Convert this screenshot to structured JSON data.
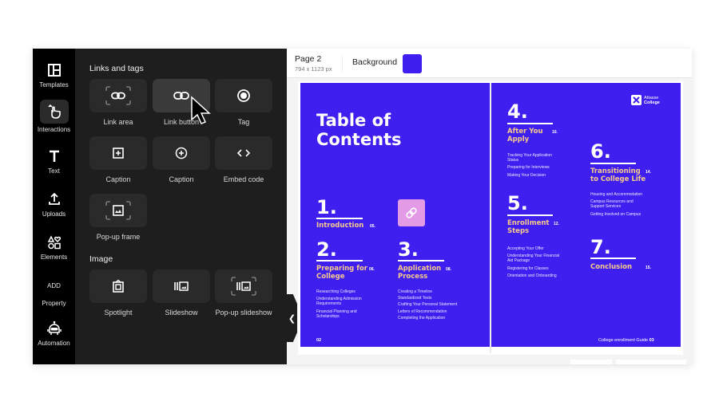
{
  "rail": {
    "items": [
      {
        "label": "Templates",
        "icon": "layout-icon"
      },
      {
        "label": "Interactions",
        "icon": "pointer-hand-icon",
        "active": true
      },
      {
        "label": "Text",
        "icon": "text-icon"
      },
      {
        "label": "Uploads",
        "icon": "upload-icon"
      },
      {
        "label": "Elements",
        "icon": "shapes-icon"
      },
      {
        "label": "ADD",
        "icon": ""
      },
      {
        "label": "Property",
        "icon": ""
      },
      {
        "label": "Automation",
        "icon": "robot-icon"
      }
    ]
  },
  "panel": {
    "sections": [
      {
        "title": "Links and tags",
        "items": [
          {
            "label": "Link area",
            "icon": "link-area-icon"
          },
          {
            "label": "Link button",
            "icon": "link-icon",
            "hovered": true
          },
          {
            "label": "Tag",
            "icon": "tag-dot-icon"
          },
          {
            "label": "Caption",
            "icon": "plus-square-icon"
          },
          {
            "label": "Caption",
            "icon": "plus-circle-icon"
          },
          {
            "label": "Embed code",
            "icon": "code-icon"
          },
          {
            "label": "Pop-up frame",
            "icon": "popup-frame-icon"
          }
        ]
      },
      {
        "title": "Image",
        "items": [
          {
            "label": "Spotlight",
            "icon": "spotlight-icon"
          },
          {
            "label": "Slideshow",
            "icon": "slideshow-icon"
          },
          {
            "label": "Pop-up slideshow",
            "icon": "popup-slideshow-icon"
          }
        ]
      }
    ]
  },
  "topbar": {
    "page_name": "Page 2",
    "page_size": "794 x 1123 px",
    "background_label": "Background",
    "background_color": "#3f1ff0"
  },
  "document": {
    "left": {
      "title_line1": "Table of",
      "title_line2": "Contents",
      "chapters": [
        {
          "num": "1.",
          "title": [
            "Introduction"
          ],
          "page": "05.",
          "items": []
        },
        {
          "num": "2.",
          "title": [
            "Preparing for",
            "College"
          ],
          "page": "06.",
          "items": [
            "Researching Colleges",
            "Understanding Admission Requirements",
            "Financial Planning and Scholarships"
          ]
        },
        {
          "num": "3.",
          "title": [
            "Application",
            "Process"
          ],
          "page": "08.",
          "items": [
            "Creating a Timeline",
            "Standardized Tests",
            "Crafting Your Personal Statement",
            "Letters of Recommendation",
            "Completing the Application"
          ]
        }
      ],
      "page_number": "02"
    },
    "right": {
      "logo_line1": "Attasse",
      "logo_line2": "College",
      "chapters": [
        {
          "num": "4.",
          "title": [
            "After You",
            "Apply"
          ],
          "page": "10.",
          "items": [
            "Tracking Your Application Status",
            "Preparing for Interviews",
            "Making Your Decision"
          ]
        },
        {
          "num": "5.",
          "title": [
            "Enrollment",
            "Steps"
          ],
          "page": "12.",
          "items": [
            "Accepting Your Offer",
            "Understanding Your Financial Aid Package",
            "Registering for Classes",
            "Orientation and Onboarding"
          ]
        },
        {
          "num": "6.",
          "title": [
            "Transitioning",
            "to College Life"
          ],
          "page": "14.",
          "items": [
            "Housing and Accommodation",
            "Campus Resources and Support Services",
            "Getting Involved on Campus"
          ]
        },
        {
          "num": "7.",
          "title": [
            "Conclusion"
          ],
          "page": "15.",
          "items": []
        }
      ],
      "footer_text": "College enrollment Guide",
      "page_number": "03"
    }
  },
  "colors": {
    "accent": "#3f1ff0",
    "chapter_title": "#f7c98a",
    "link_button": "#e49be6"
  }
}
